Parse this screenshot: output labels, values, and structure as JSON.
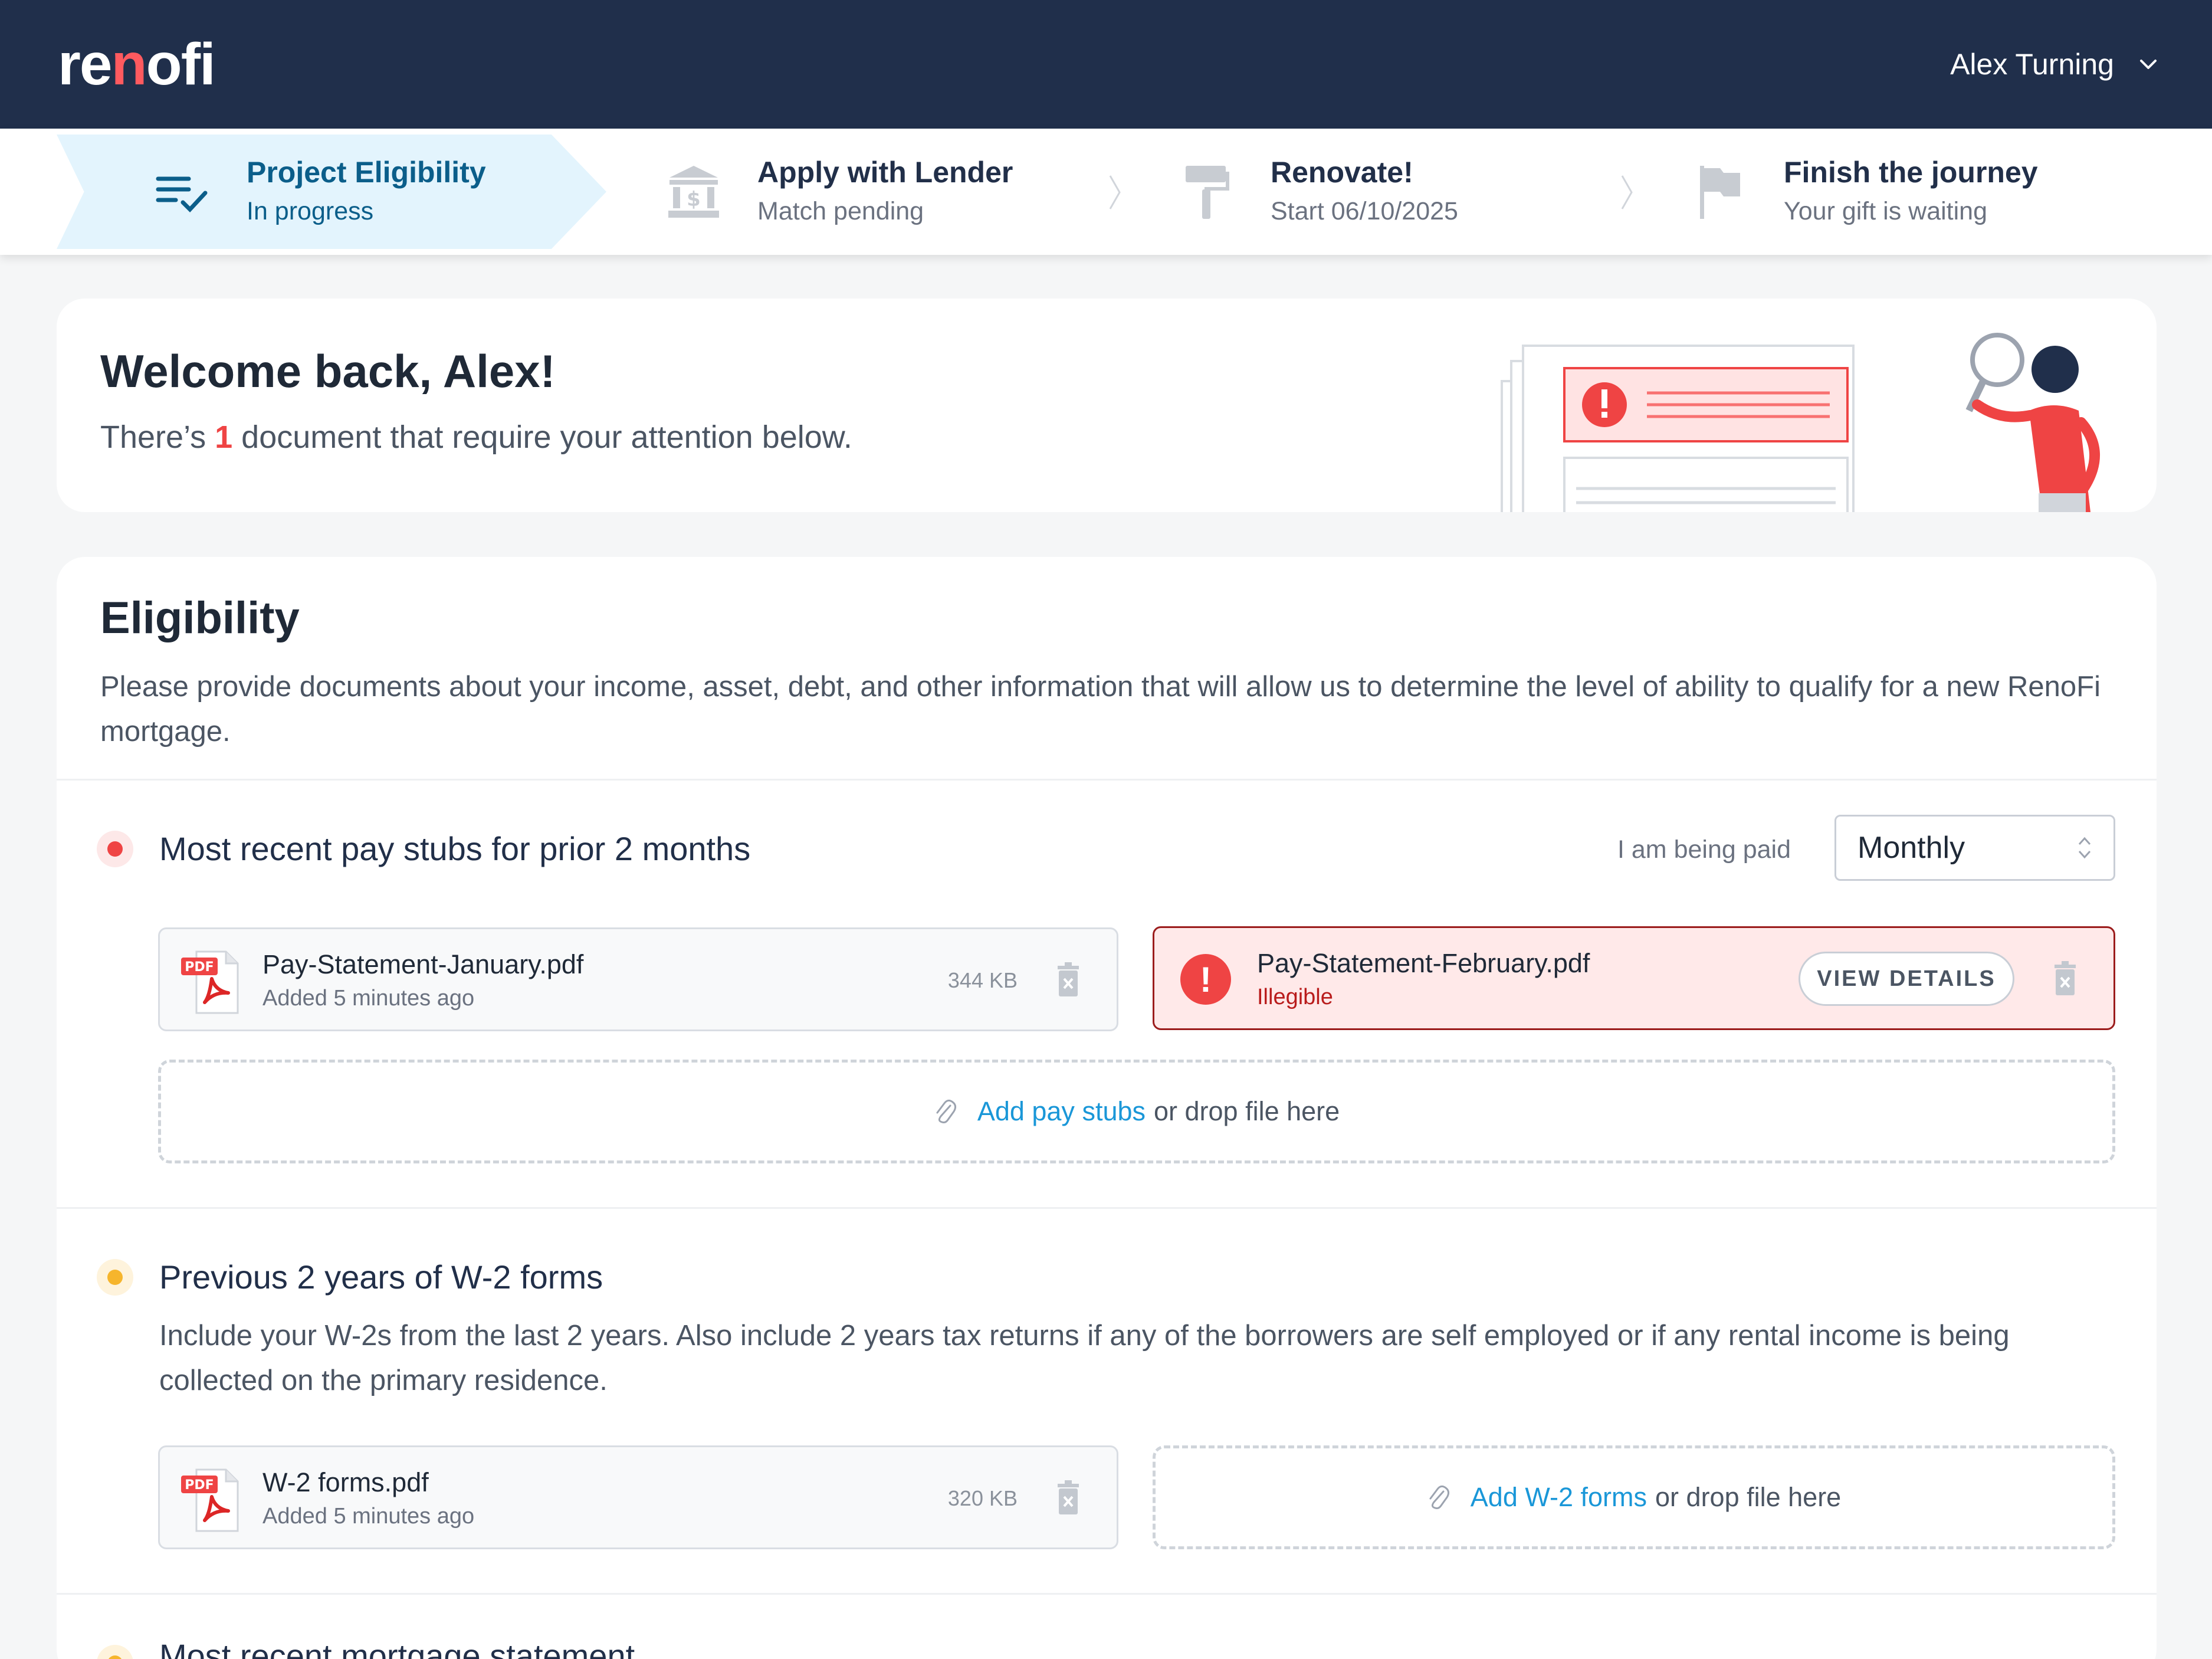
{
  "header": {
    "logo_pre": "re",
    "logo_n": "n",
    "logo_post": "ofi",
    "user_name": "Alex Turning"
  },
  "stepper": {
    "steps": [
      {
        "title": "Project Eligibility",
        "subtitle": "In progress",
        "icon": "checklist-icon",
        "active": true
      },
      {
        "title": "Apply with Lender",
        "subtitle": "Match pending",
        "icon": "bank-icon",
        "active": false
      },
      {
        "title": "Renovate!",
        "subtitle": "Start 06/10/2025",
        "icon": "paint-roller-icon",
        "active": false
      },
      {
        "title": "Finish the journey",
        "subtitle": "Your gift is waiting",
        "icon": "flag-icon",
        "active": false
      }
    ]
  },
  "welcome": {
    "title": "Welcome back, Alex!",
    "sub_pre": "There’s",
    "sub_count": "1",
    "sub_post": "document that require your attention below."
  },
  "eligibility": {
    "title": "Eligibility",
    "description": "Please provide documents about your income, asset, debt, and other information that will allow us to determine the level of ability to qualify for a new RenoFi mortgage.",
    "sections": [
      {
        "title": "Most recent pay stubs for prior 2 months",
        "status_color": "#ef4444",
        "paid_label": "I am being paid",
        "paid_value": "Monthly",
        "files": [
          {
            "name": "Pay-Statement-January.pdf",
            "meta": "Added 5 minutes ago",
            "size": "344 KB"
          },
          {
            "name": "Pay-Statement-February.pdf",
            "meta": "Illegible",
            "action": "VIEW DETAILS"
          }
        ],
        "drop_link": "Add pay stubs",
        "drop_text": "or drop file here"
      },
      {
        "title": "Previous 2 years of W-2 forms",
        "status_color": "#f6b52c",
        "description": "Include your W-2s from the last 2 years. Also include 2 years tax returns if any of the borrowers are self employed or if any rental income is being collected on the primary residence.",
        "files": [
          {
            "name": "W-2 forms.pdf",
            "meta": "Added 5 minutes ago",
            "size": "320 KB"
          }
        ],
        "drop_link": "Add W-2 forms",
        "drop_text": "or drop file here"
      },
      {
        "title": "Most recent mortgage statement",
        "status_color": "#f6b52c"
      }
    ]
  },
  "colors": {
    "navy": "#202f4b",
    "brand_red": "#ff5a5f",
    "link_blue": "#1a97d8",
    "active_step_bg": "#e3f4fd"
  }
}
